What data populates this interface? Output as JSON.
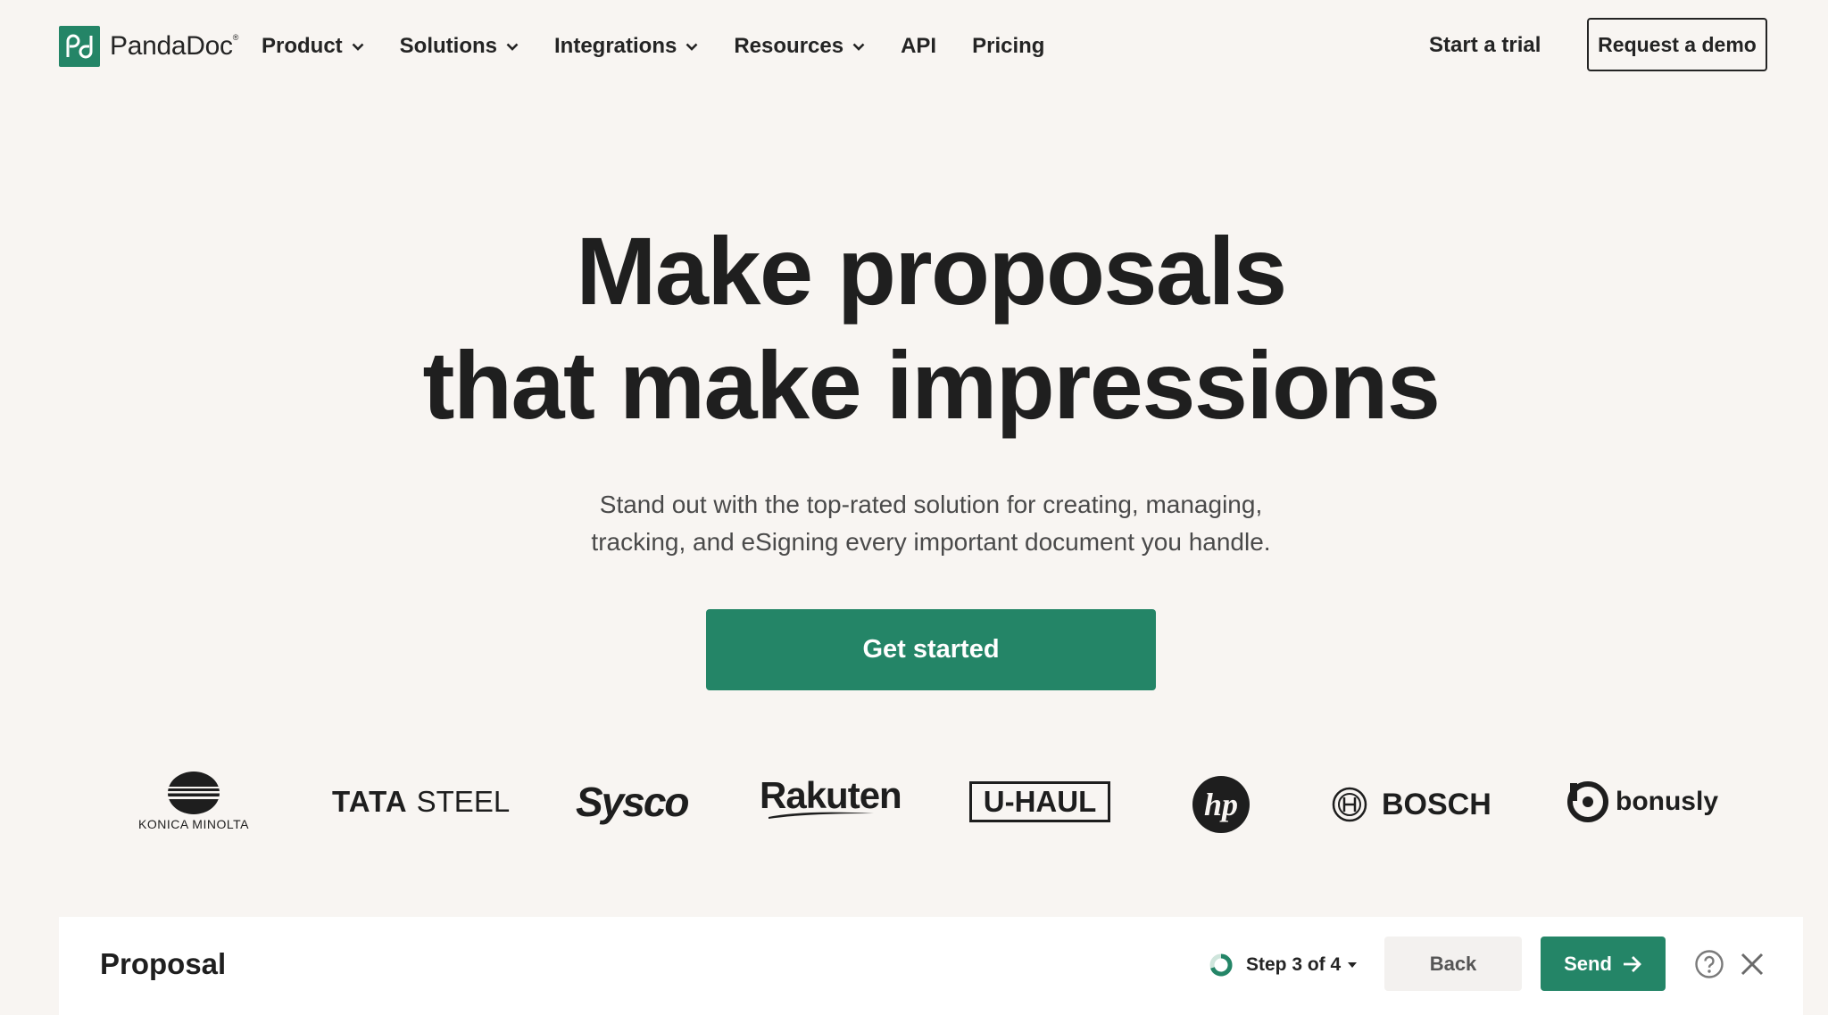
{
  "header": {
    "logo_text": "PandaDoc",
    "logo_mark": "®",
    "nav": [
      {
        "label": "Product",
        "dropdown": true
      },
      {
        "label": "Solutions",
        "dropdown": true
      },
      {
        "label": "Integrations",
        "dropdown": true
      },
      {
        "label": "Resources",
        "dropdown": true
      },
      {
        "label": "API",
        "dropdown": false
      },
      {
        "label": "Pricing",
        "dropdown": false
      }
    ],
    "trial_label": "Start a trial",
    "demo_label": "Request a demo"
  },
  "hero": {
    "title_line1": "Make proposals",
    "title_line2": "that make impressions",
    "subtitle_line1": "Stand out with the top-rated solution for creating, managing,",
    "subtitle_line2": "tracking, and eSigning every important document you handle.",
    "cta_label": "Get started"
  },
  "logos": {
    "konica": "KONICA MINOLTA",
    "tata_a": "TATA",
    "tata_b": "STEEL",
    "sysco": "Sysco",
    "rakuten": "Rakuten",
    "uhaul": "U-HAUL",
    "hp": "hp",
    "bosch": "BOSCH",
    "bonusly": "bonusly"
  },
  "proposal_bar": {
    "title": "Proposal",
    "step_label": "Step 3 of 4",
    "back_label": "Back",
    "send_label": "Send"
  },
  "colors": {
    "brand_green": "#248567",
    "background": "#f8f5f2",
    "text": "#242424"
  },
  "icons": [
    "pandadoc-logo-icon",
    "chevron-down-icon",
    "progress-ring-icon",
    "caret-down-icon",
    "arrow-right-icon",
    "help-icon",
    "close-icon"
  ]
}
